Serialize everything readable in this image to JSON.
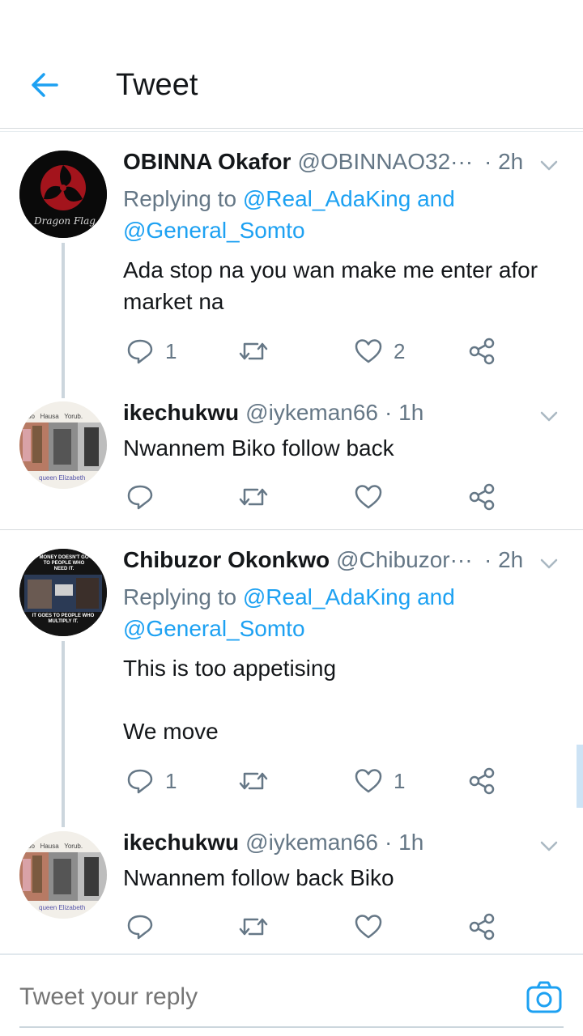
{
  "header": {
    "title": "Tweet"
  },
  "threads": [
    {
      "tweet": {
        "name": "OBINNA Okafor",
        "handle": "@OBINNAO32···",
        "time": "· 2h",
        "replying_prefix": "Replying to ",
        "mention1": "@Real_AdaKing",
        "replying_and": " and",
        "mention2": "@General_Somto",
        "text": "Ada stop na you wan make me enter afor market na",
        "reply_count": "1",
        "retweet_count": "",
        "like_count": "2",
        "avatar_text": "Dragon Flag"
      },
      "reply": {
        "name": "ikechukwu",
        "handle": "@iykeman66",
        "time": "· 1h",
        "text": "Nwannem Biko follow back",
        "avatar_top": "bo   Hausa   Yorub.",
        "avatar_bottom": "queen Elizabeth"
      }
    },
    {
      "tweet": {
        "name": "Chibuzor Okonkwo",
        "handle": "@Chibuzor···",
        "time": "· 2h",
        "replying_prefix": "Replying to ",
        "mention1": "@Real_AdaKing",
        "replying_and": " and",
        "mention2": "@General_Somto",
        "text": "This is too appetising\n\nWe move",
        "reply_count": "1",
        "retweet_count": "",
        "like_count": "1",
        "avatar_top": "MONEY DOESN'T GO TO PEOPLE WHO NEED IT.",
        "avatar_bottom": "IT GOES TO PEOPLE WHO MULTIPLY IT."
      },
      "reply": {
        "name": "ikechukwu",
        "handle": "@iykeman66",
        "time": "· 1h",
        "text": "Nwannem follow back Biko",
        "avatar_top": "bo   Hausa   Yorub.",
        "avatar_bottom": "queen Elizabeth"
      }
    }
  ],
  "composer": {
    "placeholder": "Tweet your reply"
  },
  "colors": {
    "accent": "#1da1f2",
    "text": "#14171a",
    "muted": "#657786",
    "divider": "#d6dadd",
    "thread": "#ccd6dd"
  },
  "icons": [
    "back-arrow-icon",
    "chevron-down-icon",
    "reply-icon",
    "retweet-icon",
    "like-icon",
    "share-icon",
    "camera-icon"
  ]
}
